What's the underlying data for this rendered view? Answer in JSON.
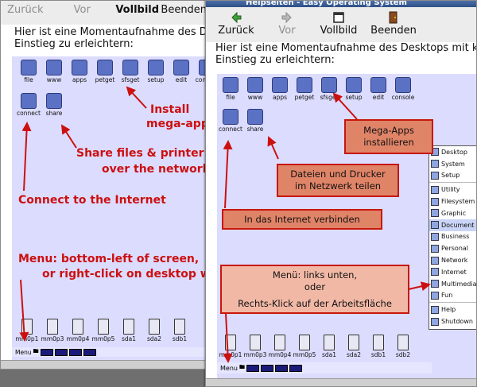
{
  "back_window": {
    "toolbar": {
      "back": "Zurück",
      "forward": "Vor",
      "fullscreen": "Vollbild",
      "quit": "Beenden"
    },
    "intro_line1": "Hier ist eine Momentaufnahme des Des",
    "intro_line2": "Einstieg zu erleichtern:",
    "desktop_icons": [
      "file",
      "www",
      "apps",
      "petget",
      "sfsget",
      "setup",
      "edit",
      "console",
      "connect",
      "share"
    ],
    "drives": [
      "mm0p1",
      "mm0p3",
      "mm0p4",
      "mm0p5",
      "sda1",
      "sda2",
      "sdb1"
    ],
    "taskbar_menu": "Menu",
    "notes": {
      "install_1": "Install",
      "install_2": "mega-app",
      "share_1": "Share files & printer",
      "share_2": "over the network",
      "connect": "Connect to the Internet",
      "menu_1": "Menu: bottom-left of screen,",
      "menu_2": "or right-click on desktop w"
    }
  },
  "front_window": {
    "titlebar": "Helpseiten - Easy Operating System",
    "toolbar": {
      "back": "Zurück",
      "forward": "Vor",
      "fullscreen": "Vollbild",
      "quit": "Beenden"
    },
    "intro_line1": "Hier ist eine Momentaufnahme des Desktops mit kurz",
    "intro_line2": "Einstieg zu erleichtern:",
    "desktop_icons": [
      "file",
      "www",
      "apps",
      "petget",
      "sfsget",
      "setup",
      "edit",
      "console",
      "connect",
      "share"
    ],
    "drives": [
      "mm0p1",
      "mm0p3",
      "mm0p4",
      "mm0p5",
      "sda1",
      "sda2",
      "sdb1",
      "sdb2"
    ],
    "taskbar_menu": "Menu",
    "callouts": {
      "megaapps_1": "Mega-Apps",
      "megaapps_2": "installieren",
      "share_1": "Dateien und Drucker",
      "share_2": "im Netzwerk teilen",
      "connect": "In das Internet verbinden",
      "menu_1": "Menü: links unten,",
      "menu_2": "oder",
      "menu_3": "Rechts-Klick auf der Arbeitsfläche"
    },
    "menu_items": [
      "Desktop",
      "System",
      "Setup",
      "Utility",
      "Filesystem",
      "Graphic",
      "Document",
      "Business",
      "Personal",
      "Network",
      "Internet",
      "Multimedia",
      "Fun",
      "Help",
      "Shutdown"
    ],
    "menu_selected": "Document"
  },
  "colors": {
    "desktop_bg": "#dcdcff",
    "accent_red": "#cc1010",
    "callout_fill": "#e08468"
  }
}
